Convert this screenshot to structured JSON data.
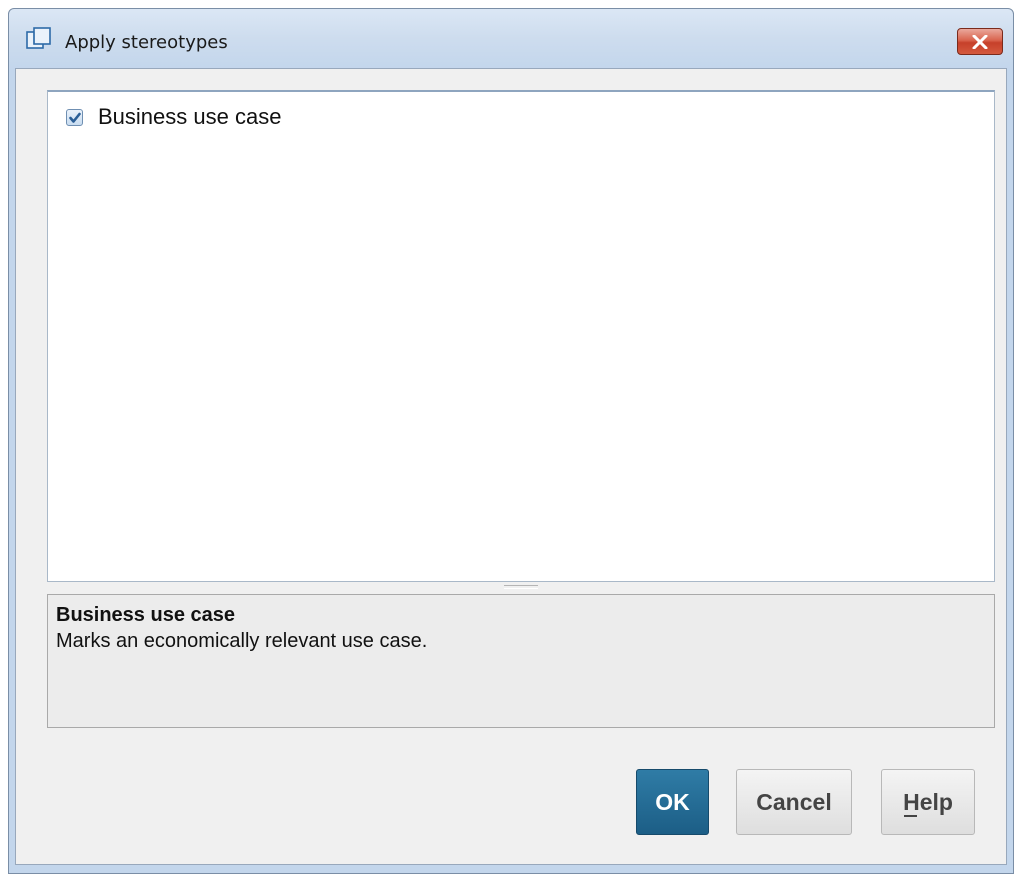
{
  "window": {
    "title": "Apply stereotypes",
    "close_icon": "close-icon",
    "title_icon": "window-icon"
  },
  "stereotypes": {
    "items": [
      {
        "label": "Business use case",
        "checked": true
      }
    ]
  },
  "description": {
    "title": "Business use case",
    "text": "Marks an economically relevant use case."
  },
  "buttons": {
    "ok_label": "OK",
    "cancel_label": "Cancel",
    "help_label": "Help",
    "help_mnemonic": "H"
  },
  "colors": {
    "primary_button": "#1f6a94",
    "close_button": "#c6402a"
  }
}
